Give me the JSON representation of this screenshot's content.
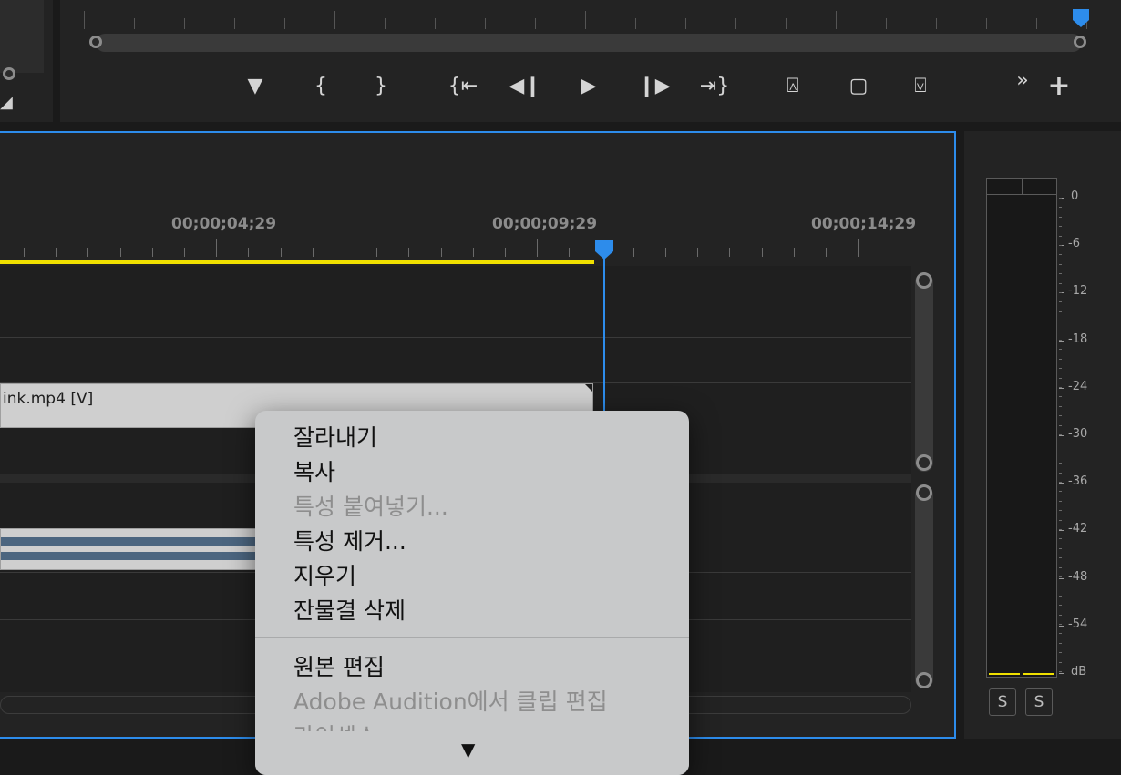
{
  "monitor": {
    "controls": [
      {
        "icon": "marker-icon",
        "glyph": "▼"
      },
      {
        "icon": "mark-in-icon",
        "glyph": "{"
      },
      {
        "icon": "mark-out-icon",
        "glyph": "}"
      },
      {
        "icon": "go-to-in-icon",
        "glyph": "{⇤"
      },
      {
        "icon": "step-back-icon",
        "glyph": "◀❙"
      },
      {
        "icon": "play-icon",
        "glyph": "▶"
      },
      {
        "icon": "step-forward-icon",
        "glyph": "❙▶"
      },
      {
        "icon": "go-to-out-icon",
        "glyph": "⇥}"
      },
      {
        "icon": "lift-icon",
        "glyph": "⍓"
      },
      {
        "icon": "export-frame-icon",
        "glyph": "▢"
      },
      {
        "icon": "extract-icon",
        "glyph": "⍌"
      },
      {
        "icon": "more-icon",
        "glyph": "»"
      },
      {
        "icon": "add-button-icon",
        "glyph": "+"
      }
    ]
  },
  "timeline": {
    "timecodes": [
      "00;00;04;29",
      "00;00;09;29",
      "00;00;14;29"
    ],
    "video_clip_label": "ink.mp4 [V]",
    "colors": {
      "work_area": "#f0e000",
      "playhead": "#2d8ceb"
    }
  },
  "meter": {
    "db_labels": [
      "0",
      "-6",
      "-12",
      "-18",
      "-24",
      "-30",
      "-36",
      "-42",
      "-48",
      "-54",
      "dB"
    ],
    "solo_buttons": [
      "S",
      "S"
    ]
  },
  "context_menu": {
    "items": [
      {
        "label": "잘라내기",
        "enabled": true
      },
      {
        "label": "복사",
        "enabled": true
      },
      {
        "label": "특성 붙여넣기...",
        "enabled": false
      },
      {
        "label": "특성 제거...",
        "enabled": true
      },
      {
        "label": "지우기",
        "enabled": true
      },
      {
        "label": "잔물결 삭제",
        "enabled": true
      },
      {
        "label": "원본 편집",
        "enabled": true
      },
      {
        "label": "Adobe Audition에서 클립 편집",
        "enabled": false
      },
      {
        "label": "라이센스",
        "enabled": false
      }
    ],
    "scroll_down_glyph": "▼"
  }
}
